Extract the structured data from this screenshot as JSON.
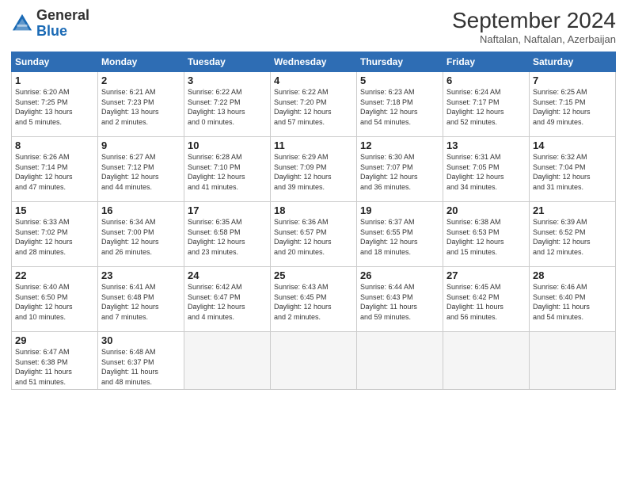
{
  "header": {
    "logo_general": "General",
    "logo_blue": "Blue",
    "title": "September 2024",
    "location": "Naftalan, Naftalan, Azerbaijan"
  },
  "days_of_week": [
    "Sunday",
    "Monday",
    "Tuesday",
    "Wednesday",
    "Thursday",
    "Friday",
    "Saturday"
  ],
  "weeks": [
    [
      {
        "day": "1",
        "info": "Sunrise: 6:20 AM\nSunset: 7:25 PM\nDaylight: 13 hours\nand 5 minutes."
      },
      {
        "day": "2",
        "info": "Sunrise: 6:21 AM\nSunset: 7:23 PM\nDaylight: 13 hours\nand 2 minutes."
      },
      {
        "day": "3",
        "info": "Sunrise: 6:22 AM\nSunset: 7:22 PM\nDaylight: 13 hours\nand 0 minutes."
      },
      {
        "day": "4",
        "info": "Sunrise: 6:22 AM\nSunset: 7:20 PM\nDaylight: 12 hours\nand 57 minutes."
      },
      {
        "day": "5",
        "info": "Sunrise: 6:23 AM\nSunset: 7:18 PM\nDaylight: 12 hours\nand 54 minutes."
      },
      {
        "day": "6",
        "info": "Sunrise: 6:24 AM\nSunset: 7:17 PM\nDaylight: 12 hours\nand 52 minutes."
      },
      {
        "day": "7",
        "info": "Sunrise: 6:25 AM\nSunset: 7:15 PM\nDaylight: 12 hours\nand 49 minutes."
      }
    ],
    [
      {
        "day": "8",
        "info": "Sunrise: 6:26 AM\nSunset: 7:14 PM\nDaylight: 12 hours\nand 47 minutes."
      },
      {
        "day": "9",
        "info": "Sunrise: 6:27 AM\nSunset: 7:12 PM\nDaylight: 12 hours\nand 44 minutes."
      },
      {
        "day": "10",
        "info": "Sunrise: 6:28 AM\nSunset: 7:10 PM\nDaylight: 12 hours\nand 41 minutes."
      },
      {
        "day": "11",
        "info": "Sunrise: 6:29 AM\nSunset: 7:09 PM\nDaylight: 12 hours\nand 39 minutes."
      },
      {
        "day": "12",
        "info": "Sunrise: 6:30 AM\nSunset: 7:07 PM\nDaylight: 12 hours\nand 36 minutes."
      },
      {
        "day": "13",
        "info": "Sunrise: 6:31 AM\nSunset: 7:05 PM\nDaylight: 12 hours\nand 34 minutes."
      },
      {
        "day": "14",
        "info": "Sunrise: 6:32 AM\nSunset: 7:04 PM\nDaylight: 12 hours\nand 31 minutes."
      }
    ],
    [
      {
        "day": "15",
        "info": "Sunrise: 6:33 AM\nSunset: 7:02 PM\nDaylight: 12 hours\nand 28 minutes."
      },
      {
        "day": "16",
        "info": "Sunrise: 6:34 AM\nSunset: 7:00 PM\nDaylight: 12 hours\nand 26 minutes."
      },
      {
        "day": "17",
        "info": "Sunrise: 6:35 AM\nSunset: 6:58 PM\nDaylight: 12 hours\nand 23 minutes."
      },
      {
        "day": "18",
        "info": "Sunrise: 6:36 AM\nSunset: 6:57 PM\nDaylight: 12 hours\nand 20 minutes."
      },
      {
        "day": "19",
        "info": "Sunrise: 6:37 AM\nSunset: 6:55 PM\nDaylight: 12 hours\nand 18 minutes."
      },
      {
        "day": "20",
        "info": "Sunrise: 6:38 AM\nSunset: 6:53 PM\nDaylight: 12 hours\nand 15 minutes."
      },
      {
        "day": "21",
        "info": "Sunrise: 6:39 AM\nSunset: 6:52 PM\nDaylight: 12 hours\nand 12 minutes."
      }
    ],
    [
      {
        "day": "22",
        "info": "Sunrise: 6:40 AM\nSunset: 6:50 PM\nDaylight: 12 hours\nand 10 minutes."
      },
      {
        "day": "23",
        "info": "Sunrise: 6:41 AM\nSunset: 6:48 PM\nDaylight: 12 hours\nand 7 minutes."
      },
      {
        "day": "24",
        "info": "Sunrise: 6:42 AM\nSunset: 6:47 PM\nDaylight: 12 hours\nand 4 minutes."
      },
      {
        "day": "25",
        "info": "Sunrise: 6:43 AM\nSunset: 6:45 PM\nDaylight: 12 hours\nand 2 minutes."
      },
      {
        "day": "26",
        "info": "Sunrise: 6:44 AM\nSunset: 6:43 PM\nDaylight: 11 hours\nand 59 minutes."
      },
      {
        "day": "27",
        "info": "Sunrise: 6:45 AM\nSunset: 6:42 PM\nDaylight: 11 hours\nand 56 minutes."
      },
      {
        "day": "28",
        "info": "Sunrise: 6:46 AM\nSunset: 6:40 PM\nDaylight: 11 hours\nand 54 minutes."
      }
    ],
    [
      {
        "day": "29",
        "info": "Sunrise: 6:47 AM\nSunset: 6:38 PM\nDaylight: 11 hours\nand 51 minutes."
      },
      {
        "day": "30",
        "info": "Sunrise: 6:48 AM\nSunset: 6:37 PM\nDaylight: 11 hours\nand 48 minutes."
      },
      {
        "day": "",
        "info": ""
      },
      {
        "day": "",
        "info": ""
      },
      {
        "day": "",
        "info": ""
      },
      {
        "day": "",
        "info": ""
      },
      {
        "day": "",
        "info": ""
      }
    ]
  ]
}
